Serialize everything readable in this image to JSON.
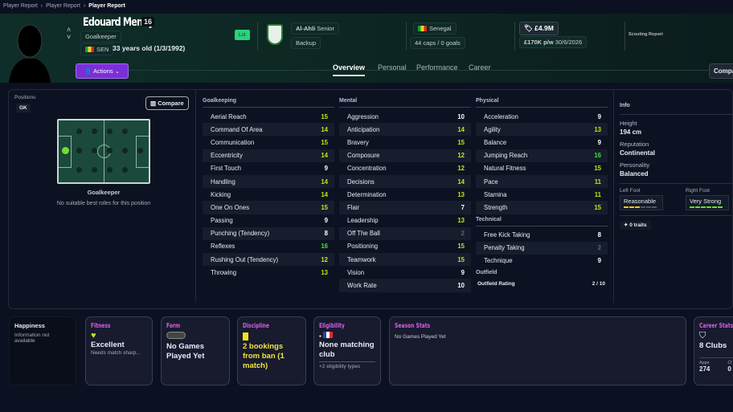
{
  "breadcrumbs": [
    "Player Report",
    "Player Report",
    "Player Report"
  ],
  "player": {
    "name": "Edouard Mendy",
    "number": "16",
    "position": "Goalkeeper",
    "nationality_code": "SEN",
    "age": "33 years old (1/3/1992)",
    "list_badge": "Lst"
  },
  "club": {
    "name": "Al-Ahli",
    "squad": "Senior",
    "status": "Backup"
  },
  "international": {
    "country": "Senegal",
    "caps": "44 caps / 0 goals"
  },
  "contract": {
    "value": "£4.9M",
    "wage": "£170K p/w",
    "expiry": "30/6/2026"
  },
  "scouting_report": "Scouting Report",
  "actions_label": "Actions",
  "tabs": [
    "Overview",
    "Personal",
    "Performance",
    "Career"
  ],
  "compare_top": "Compa",
  "positions": {
    "label": "Positions",
    "value": "GK",
    "compare": "Compare",
    "role": "Goalkeeper",
    "note": "No suitable best roles for this position"
  },
  "colors": {
    "high": "#c6e21a",
    "top": "#3ee03e",
    "normal": "#ffffff",
    "low": "#5b6272",
    "accent": "#d25fe6"
  },
  "attributes": {
    "goalkeeping": {
      "title": "Goalkeeping",
      "items": [
        [
          "Aerial Reach",
          15
        ],
        [
          "Command Of Area",
          14
        ],
        [
          "Communication",
          15
        ],
        [
          "Eccentricity",
          14
        ],
        [
          "First Touch",
          9
        ],
        [
          "Handling",
          14
        ],
        [
          "Kicking",
          14
        ],
        [
          "One On Ones",
          15
        ],
        [
          "Passing",
          9
        ],
        [
          "Punching (Tendency)",
          8
        ],
        [
          "Reflexes",
          16
        ],
        [
          "Rushing Out (Tendency)",
          12
        ],
        [
          "Throwing",
          13
        ]
      ]
    },
    "mental": {
      "title": "Mental",
      "items": [
        [
          "Aggression",
          10
        ],
        [
          "Anticipation",
          14
        ],
        [
          "Bravery",
          15
        ],
        [
          "Composure",
          12
        ],
        [
          "Concentration",
          12
        ],
        [
          "Decisions",
          14
        ],
        [
          "Determination",
          13
        ],
        [
          "Flair",
          7
        ],
        [
          "Leadership",
          13
        ],
        [
          "Off The Ball",
          2
        ],
        [
          "Positioning",
          15
        ],
        [
          "Teamwork",
          15
        ],
        [
          "Vision",
          9
        ],
        [
          "Work Rate",
          10
        ]
      ]
    },
    "physical": {
      "title": "Physical",
      "items": [
        [
          "Acceleration",
          9
        ],
        [
          "Agility",
          13
        ],
        [
          "Balance",
          9
        ],
        [
          "Jumping Reach",
          16
        ],
        [
          "Natural Fitness",
          15
        ],
        [
          "Pace",
          11
        ],
        [
          "Stamina",
          11
        ],
        [
          "Strength",
          15
        ]
      ]
    },
    "technical": {
      "title": "Technical",
      "items": [
        [
          "Free Kick Taking",
          8
        ],
        [
          "Penalty Taking",
          2
        ],
        [
          "Technique",
          9
        ]
      ]
    },
    "outfield": {
      "title": "Outfield",
      "label": "Outfield Rating",
      "value": "2 / 10"
    }
  },
  "info": {
    "title": "Info",
    "height_label": "Height",
    "height": "194 cm",
    "reputation_label": "Reputation",
    "reputation": "Continental",
    "personality_label": "Personality",
    "personality": "Balanced",
    "left_foot_label": "Left Foot",
    "left_foot": "Reasonable",
    "left_foot_level": 3,
    "right_foot_label": "Right Foot",
    "right_foot": "Very Strong",
    "right_foot_level": 6,
    "traits": "0 traits"
  },
  "cards": {
    "happiness": {
      "title": "Happiness",
      "text": "Information not available"
    },
    "fitness": {
      "title": "Fitness",
      "value": "Excellent",
      "sub": "Needs match sharp..."
    },
    "form": {
      "title": "Form",
      "value": "No Games Played Yet"
    },
    "discipline": {
      "title": "Discipline",
      "value": "2 bookings from ban (1 match)"
    },
    "eligibility": {
      "title": "Eligibility",
      "value": "None matching club",
      "sub": "+2 eligibility types"
    },
    "season": {
      "title": "Season Stats",
      "text": "No Games Played Yet"
    },
    "career": {
      "title": "Career Stats",
      "clubs": "8 Clubs",
      "apps_label": "Apps",
      "apps": "274",
      "next_label": "Cl",
      "next_value": "0"
    }
  }
}
